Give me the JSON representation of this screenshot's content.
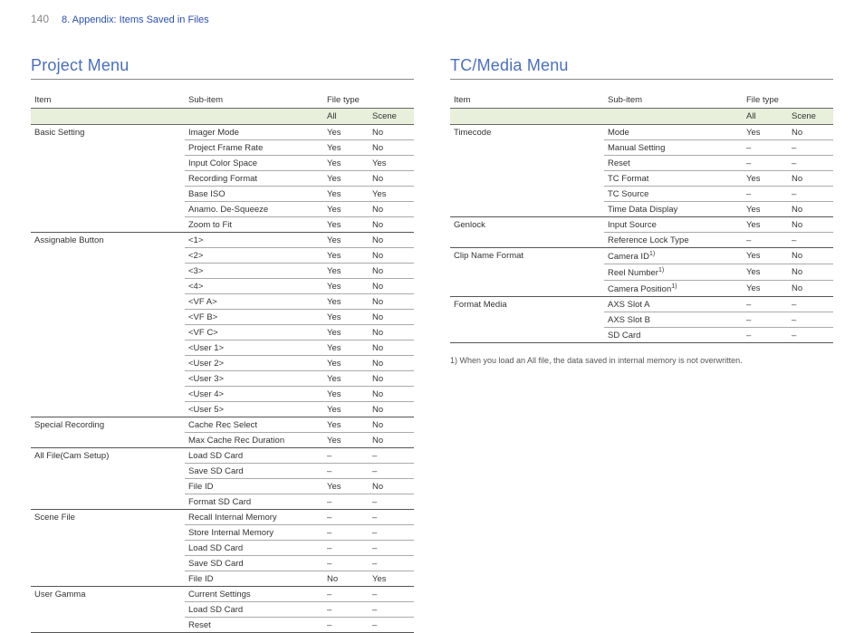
{
  "page_number": "140",
  "breadcrumb": "8. Appendix: Items Saved in Files",
  "left": {
    "title": "Project Menu",
    "headers": {
      "item": "Item",
      "sub": "Sub-item",
      "filetype": "File type",
      "all": "All",
      "scene": "Scene"
    },
    "groups": [
      {
        "item": "Basic Setting",
        "rows": [
          {
            "sub": "Imager Mode",
            "all": "Yes",
            "scene": "No"
          },
          {
            "sub": "Project Frame Rate",
            "all": "Yes",
            "scene": "No"
          },
          {
            "sub": "Input Color Space",
            "all": "Yes",
            "scene": "Yes"
          },
          {
            "sub": "Recording Format",
            "all": "Yes",
            "scene": "No"
          },
          {
            "sub": "Base ISO",
            "all": "Yes",
            "scene": "Yes"
          },
          {
            "sub": "Anamo. De-Squeeze",
            "all": "Yes",
            "scene": "No"
          },
          {
            "sub": "Zoom to Fit",
            "all": "Yes",
            "scene": "No"
          }
        ]
      },
      {
        "item": "Assignable Button",
        "rows": [
          {
            "sub": "<1>",
            "all": "Yes",
            "scene": "No"
          },
          {
            "sub": "<2>",
            "all": "Yes",
            "scene": "No"
          },
          {
            "sub": "<3>",
            "all": "Yes",
            "scene": "No"
          },
          {
            "sub": "<4>",
            "all": "Yes",
            "scene": "No"
          },
          {
            "sub": "<VF A>",
            "all": "Yes",
            "scene": "No"
          },
          {
            "sub": "<VF B>",
            "all": "Yes",
            "scene": "No"
          },
          {
            "sub": "<VF C>",
            "all": "Yes",
            "scene": "No"
          },
          {
            "sub": "<User 1>",
            "all": "Yes",
            "scene": "No"
          },
          {
            "sub": "<User 2>",
            "all": "Yes",
            "scene": "No"
          },
          {
            "sub": "<User 3>",
            "all": "Yes",
            "scene": "No"
          },
          {
            "sub": "<User 4>",
            "all": "Yes",
            "scene": "No"
          },
          {
            "sub": "<User 5>",
            "all": "Yes",
            "scene": "No"
          }
        ]
      },
      {
        "item": "Special Recording",
        "rows": [
          {
            "sub": "Cache Rec Select",
            "all": "Yes",
            "scene": "No"
          },
          {
            "sub": "Max Cache Rec Duration",
            "all": "Yes",
            "scene": "No"
          }
        ]
      },
      {
        "item": "All File(Cam Setup)",
        "rows": [
          {
            "sub": "Load SD Card",
            "all": "–",
            "scene": "–"
          },
          {
            "sub": "Save SD Card",
            "all": "–",
            "scene": "–"
          },
          {
            "sub": "File ID",
            "all": "Yes",
            "scene": "No"
          },
          {
            "sub": "Format SD Card",
            "all": "–",
            "scene": "–"
          }
        ]
      },
      {
        "item": "Scene File",
        "rows": [
          {
            "sub": "Recall Internal Memory",
            "all": "–",
            "scene": "–"
          },
          {
            "sub": "Store Internal Memory",
            "all": "–",
            "scene": "–"
          },
          {
            "sub": "Load SD Card",
            "all": "–",
            "scene": "–"
          },
          {
            "sub": "Save SD Card",
            "all": "–",
            "scene": "–"
          },
          {
            "sub": "File ID",
            "all": "No",
            "scene": "Yes"
          }
        ]
      },
      {
        "item": "User Gamma",
        "rows": [
          {
            "sub": "Current Settings",
            "all": "–",
            "scene": "–"
          },
          {
            "sub": "Load SD Card",
            "all": "–",
            "scene": "–"
          },
          {
            "sub": "Reset",
            "all": "–",
            "scene": "–"
          }
        ]
      }
    ]
  },
  "right": {
    "title": "TC/Media Menu",
    "headers": {
      "item": "Item",
      "sub": "Sub-item",
      "filetype": "File type",
      "all": "All",
      "scene": "Scene"
    },
    "groups": [
      {
        "item": "Timecode",
        "rows": [
          {
            "sub": "Mode",
            "all": "Yes",
            "scene": "No"
          },
          {
            "sub": "Manual Setting",
            "all": "–",
            "scene": "–"
          },
          {
            "sub": "Reset",
            "all": "–",
            "scene": "–"
          },
          {
            "sub": "TC Format",
            "all": "Yes",
            "scene": "No"
          },
          {
            "sub": "TC Source",
            "all": "–",
            "scene": "–"
          },
          {
            "sub": "Time Data Display",
            "all": "Yes",
            "scene": "No"
          }
        ]
      },
      {
        "item": "Genlock",
        "rows": [
          {
            "sub": "Input Source",
            "all": "Yes",
            "scene": "No"
          },
          {
            "sub": "Reference Lock Type",
            "all": "–",
            "scene": "–"
          }
        ]
      },
      {
        "item": "Clip Name Format",
        "rows": [
          {
            "sub": "Camera ID",
            "sup": "1)",
            "all": "Yes",
            "scene": "No"
          },
          {
            "sub": "Reel Number",
            "sup": "1)",
            "all": "Yes",
            "scene": "No"
          },
          {
            "sub": "Camera Position",
            "sup": "1)",
            "all": "Yes",
            "scene": "No"
          }
        ]
      },
      {
        "item": "Format Media",
        "rows": [
          {
            "sub": "AXS Slot A",
            "all": "–",
            "scene": "–"
          },
          {
            "sub": "AXS Slot B",
            "all": "–",
            "scene": "–"
          },
          {
            "sub": "SD Card",
            "all": "–",
            "scene": "–"
          }
        ]
      }
    ],
    "footnote": "1) When you load an All file, the data saved in internal memory is not overwritten."
  }
}
